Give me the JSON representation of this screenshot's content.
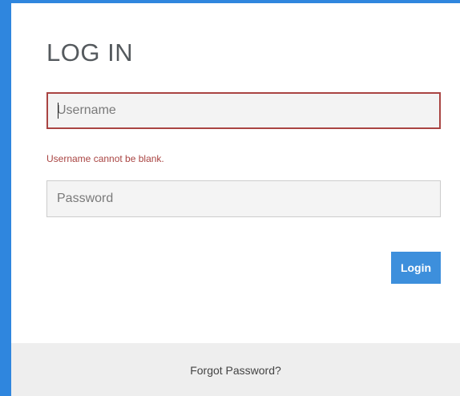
{
  "login_form": {
    "title": "LOG IN",
    "username_placeholder": "Username",
    "username_value": "",
    "username_error": "Username cannot be blank.",
    "password_placeholder": "Password",
    "password_value": "",
    "login_label": "Login",
    "forgot_password_label": "Forgot Password?"
  },
  "colors": {
    "accent": "#3d8fdc",
    "page_background": "#2f86de",
    "error": "#a94442",
    "footer_background": "#eeeeee"
  }
}
